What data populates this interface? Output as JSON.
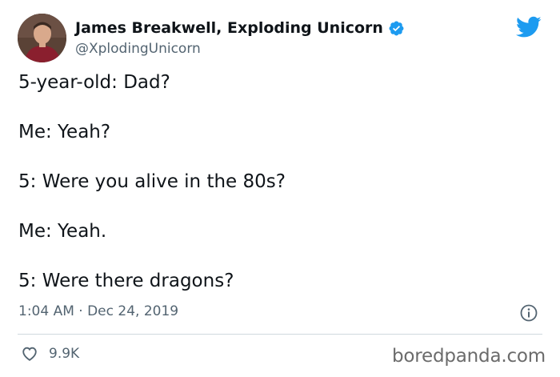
{
  "author": {
    "display_name": "James Breakwell, Exploding Unicorn",
    "handle": "@XplodingUnicorn",
    "verified": true
  },
  "tweet": {
    "lines": [
      "5-year-old: Dad?",
      "Me: Yeah?",
      "5: Were you alive in the 80s?",
      "Me: Yeah.",
      "5: Were there dragons?"
    ],
    "timestamp": "1:04 AM · Dec 24, 2019"
  },
  "engagement": {
    "like_count": "9.9K"
  },
  "watermark": "boredpanda.com",
  "icons": {
    "brand": "twitter-bird-icon",
    "verified": "verified-badge-icon",
    "info": "info-icon",
    "like": "heart-icon"
  },
  "colors": {
    "twitter_blue": "#1d9bf0",
    "secondary_text": "#536471",
    "primary_text": "#0f1419",
    "divider": "#cfd9de"
  }
}
